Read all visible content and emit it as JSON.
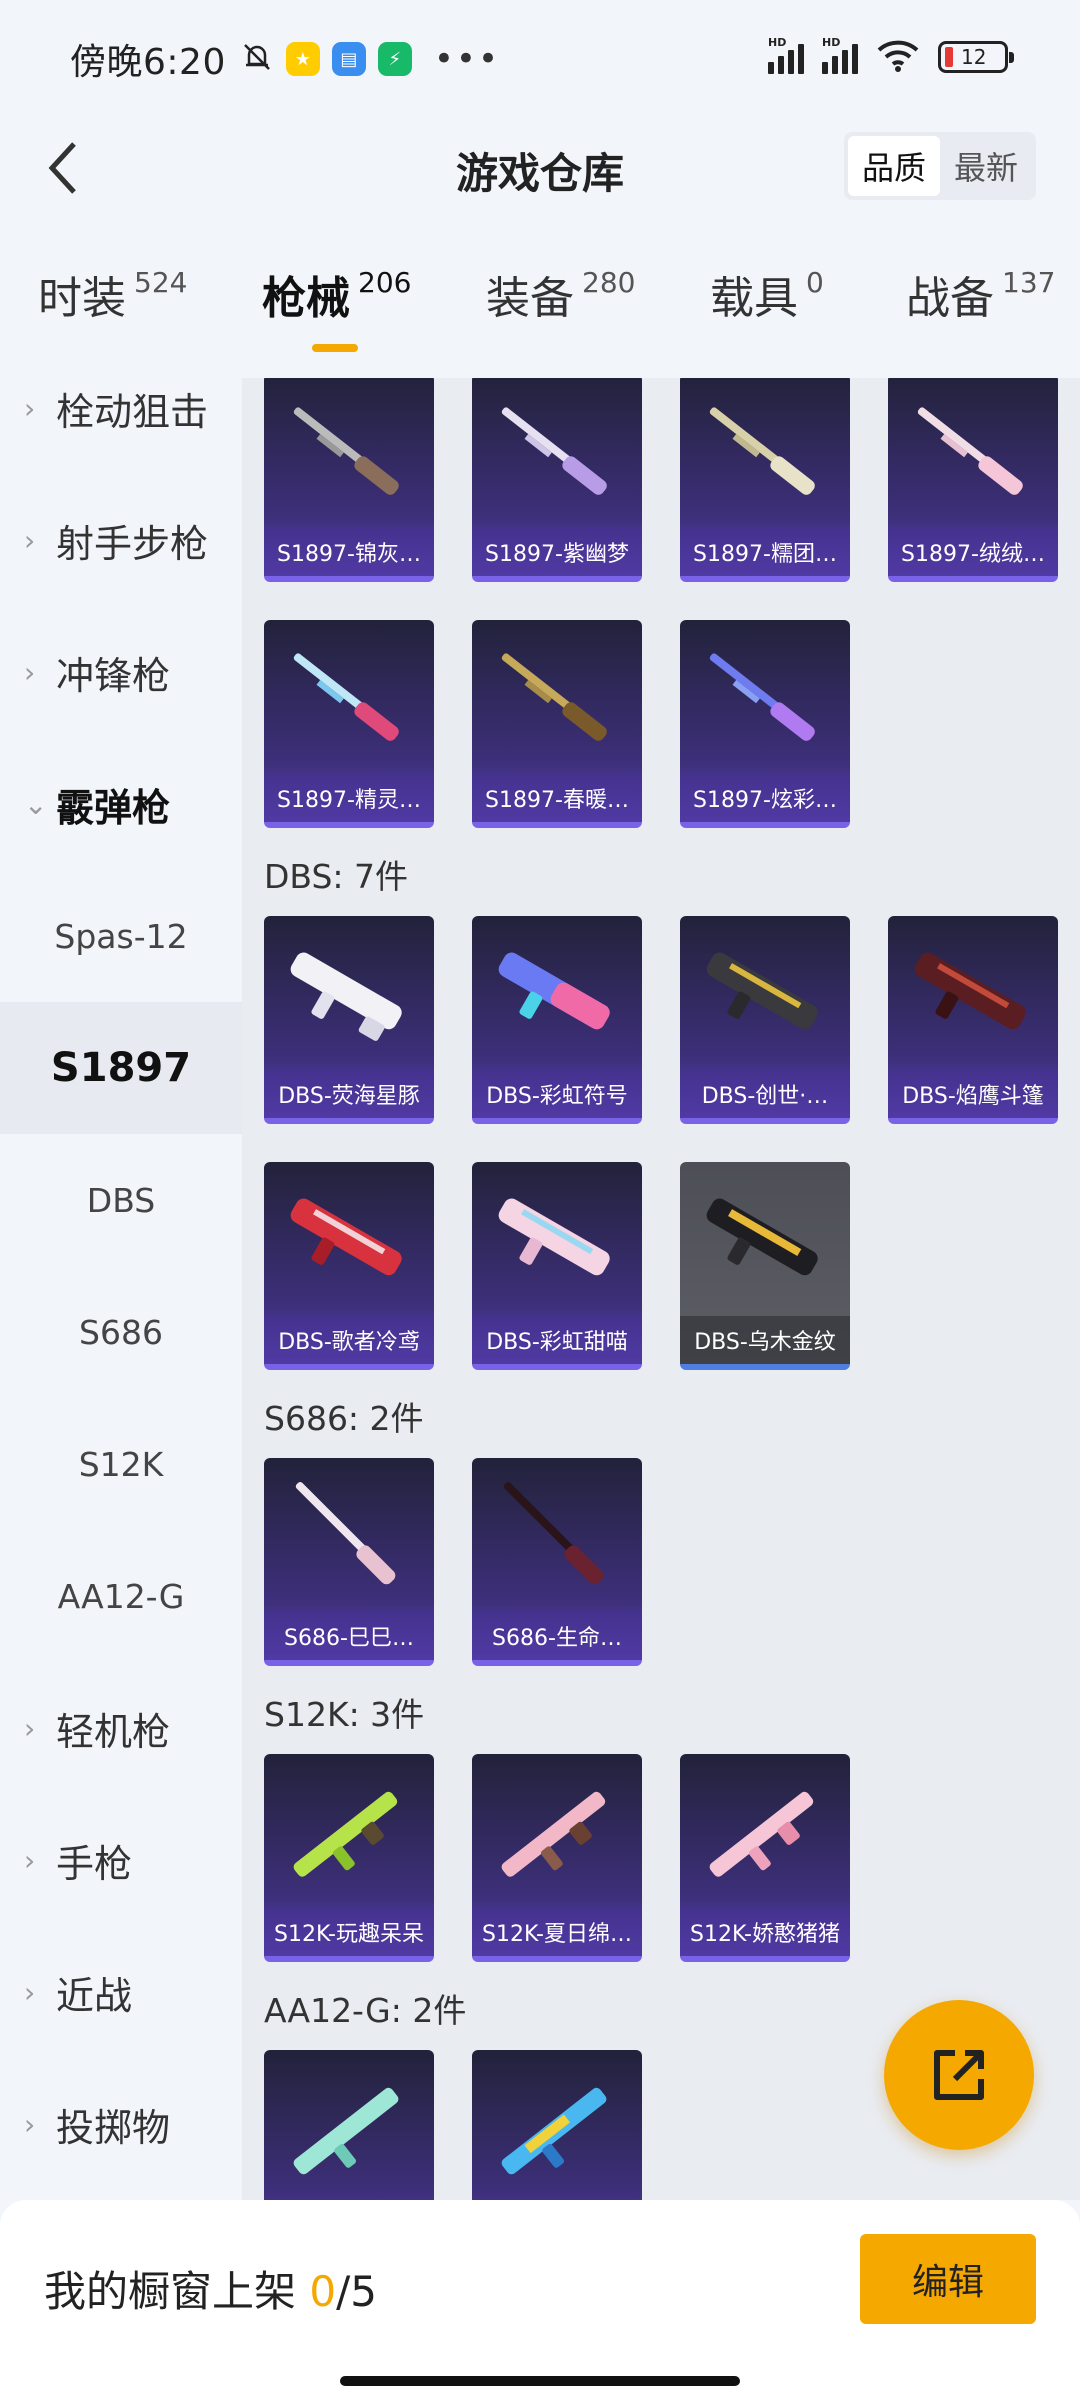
{
  "status_bar": {
    "time": "傍晚6:20",
    "battery": "12"
  },
  "header": {
    "title": "游戏仓库",
    "sort_options": [
      "品质",
      "最新"
    ],
    "sort_selected": "品质"
  },
  "tabs": [
    {
      "label": "时装",
      "count": "524"
    },
    {
      "label": "枪械",
      "count": "206"
    },
    {
      "label": "装备",
      "count": "280"
    },
    {
      "label": "载具",
      "count": "0"
    },
    {
      "label": "战备",
      "count": "137"
    }
  ],
  "active_tab": "枪械",
  "sidebar": {
    "categories_top": [
      "栓动狙击",
      "射手步枪",
      "冲锋枪"
    ],
    "open_category": "霰弹枪",
    "subcategories": [
      "Spas-12",
      "S1897",
      "DBS",
      "S686",
      "S12K",
      "AA12-G"
    ],
    "selected_sub": "S1897",
    "categories_bottom": [
      "轻机枪",
      "手枪",
      "近战",
      "投掷物"
    ]
  },
  "sections": {
    "s1897_items": [
      "S1897-锦灰…",
      "S1897-紫幽梦",
      "S1897-糯团…",
      "S1897-绒绒…",
      "S1897-精灵…",
      "S1897-春暖…",
      "S1897-炫彩…"
    ],
    "dbs_title": "DBS: 7件",
    "dbs_items": [
      "DBS-荧海星豚",
      "DBS-彩虹符号",
      "DBS-创世·…",
      "DBS-焰鹰斗篷",
      "DBS-歌者冷鸢",
      "DBS-彩虹甜喵",
      "DBS-乌木金纹"
    ],
    "s686_title": "S686: 2件",
    "s686_items": [
      "S686-巳巳…",
      "S686-生命…"
    ],
    "s12k_title": "S12K: 3件",
    "s12k_items": [
      "S12K-玩趣呆呆",
      "S12K-夏日绵…",
      "S12K-娇憨猪猪"
    ],
    "aa12_title": "AA12-G: 2件"
  },
  "bottom": {
    "showcase_label": "我的橱窗上架",
    "showcase_current": "0",
    "showcase_total": "/5",
    "edit_label": "编辑"
  },
  "colors": {
    "accent": "#f5a800",
    "card_purple": "#3d2f7a",
    "card_border": "#7a62e6"
  }
}
